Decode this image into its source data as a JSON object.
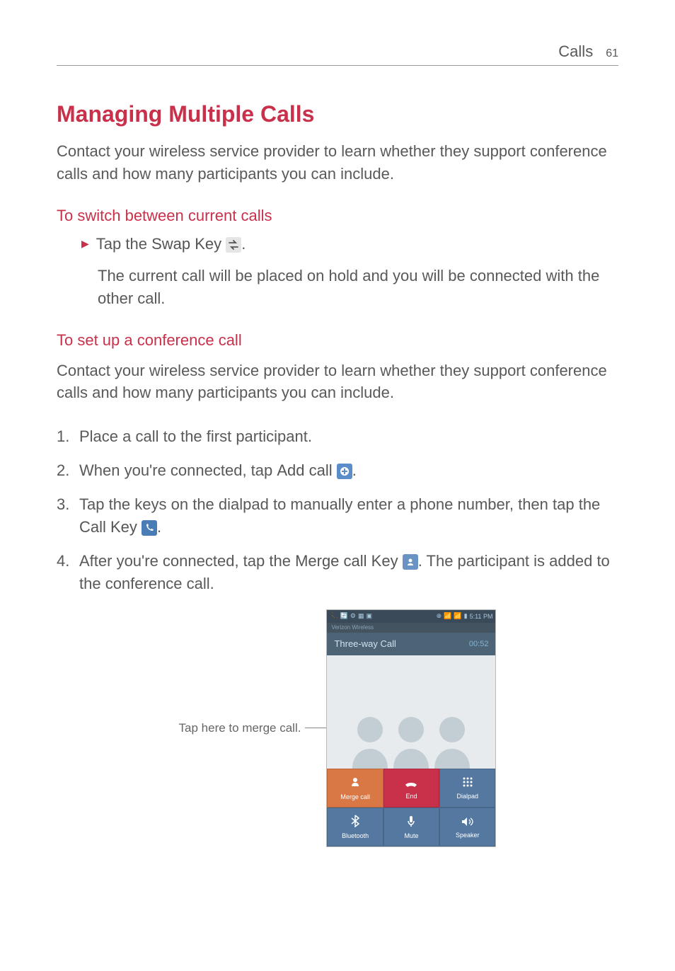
{
  "header": {
    "section": "Calls",
    "page": "61"
  },
  "title": "Managing Multiple Calls",
  "intro": "Contact your wireless service provider to learn whether they support conference calls and how many participants you can include.",
  "section1": {
    "heading": "To switch between current calls",
    "bullet_prefix": "Tap the ",
    "bullet_bold": "Swap Key ",
    "bullet_suffix": ".",
    "result": "The current call will be placed on hold and you will be connected with the other call."
  },
  "section2": {
    "heading": "To set up a conference call",
    "intro": "Contact your wireless service provider to learn whether they support conference calls and how many participants you can include.",
    "steps": [
      {
        "num": "1.",
        "text": "Place a call to the first participant."
      },
      {
        "num": "2.",
        "pre": "When you're connected, tap ",
        "bold": "Add call ",
        "icon": "add",
        "post": "."
      },
      {
        "num": "3.",
        "pre": "Tap the keys on the dialpad to manually enter a phone number, then tap the ",
        "bold": "Call Key ",
        "icon": "call",
        "post": "."
      },
      {
        "num": "4.",
        "pre": "After you're connected, tap the ",
        "bold": "Merge call Key ",
        "icon": "merge",
        "post": ". The participant is added to the conference call."
      }
    ]
  },
  "callout": "Tap here to merge call.",
  "phone": {
    "carrier": "Verizon Wireless",
    "time": "5:11 PM",
    "call_title": "Three-way Call",
    "timer": "00:52",
    "buttons": {
      "merge": "Merge call",
      "end": "End",
      "dialpad": "Dialpad",
      "bluetooth": "Bluetooth",
      "mute": "Mute",
      "speaker": "Speaker"
    }
  }
}
